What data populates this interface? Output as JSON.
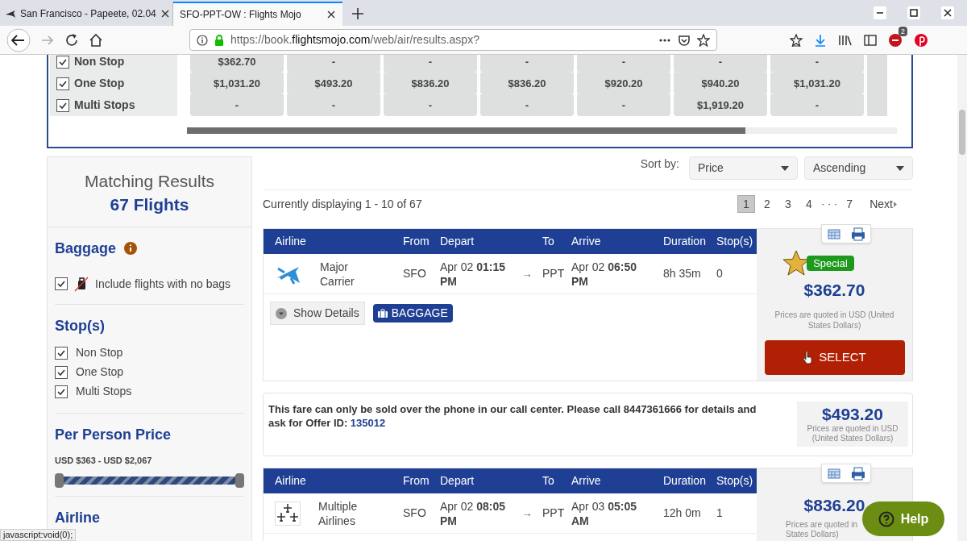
{
  "browser": {
    "tabs": [
      {
        "title": "San Francisco - Papeete, 02.04",
        "selected": false,
        "favicon": {
          "kind": "plane"
        }
      },
      {
        "title": "SFO-PPT-OW : Flights Mojo",
        "selected": true
      }
    ],
    "url": {
      "scheme": "https://book.",
      "domain": "flightsmojo.com",
      "path": "/web/air/results.aspx?"
    },
    "extension_badge": "2"
  },
  "stop_matrix": {
    "rows": [
      {
        "label": "Non Stop",
        "checked": true,
        "cells": [
          "$362.70",
          "-",
          "-",
          "-",
          "-",
          "-",
          "-"
        ]
      },
      {
        "label": "One Stop",
        "checked": true,
        "cells": [
          "$1,031.20",
          "$493.20",
          "$836.20",
          "$836.20",
          "$920.20",
          "$940.20",
          "$1,031.20"
        ]
      },
      {
        "label": "Multi Stops",
        "checked": true,
        "cells": [
          "-",
          "-",
          "-",
          "-",
          "-",
          "$1,919.20",
          "-"
        ]
      }
    ]
  },
  "sidebar": {
    "title": "Matching Results",
    "count": "67 Flights",
    "baggage": {
      "title": "Baggage",
      "option": {
        "label": "Include flights with no bags",
        "checked": true
      }
    },
    "stops": {
      "title": "Stop(s)",
      "options": [
        {
          "label": "Non Stop",
          "checked": true
        },
        {
          "label": "One Stop",
          "checked": true
        },
        {
          "label": "Multi Stops",
          "checked": true
        }
      ]
    },
    "price": {
      "title": "Per Person Price",
      "range": "USD $363 - USD $2,067"
    },
    "airline": {
      "title": "Airline"
    }
  },
  "results": {
    "sort_label": "Sort by:",
    "sort_fields": [
      "Price",
      "Ascending"
    ],
    "summary": "Currently displaying 1 - 10 of 67",
    "pages": [
      {
        "kind": "page",
        "label": "1",
        "selected": true
      },
      {
        "kind": "page",
        "label": "2",
        "selected": false
      },
      {
        "kind": "page",
        "label": "3",
        "selected": false
      },
      {
        "kind": "page",
        "label": "4",
        "selected": false
      },
      {
        "kind": "gap",
        "label": "· · ·"
      },
      {
        "kind": "page",
        "label": "7",
        "selected": false
      }
    ],
    "next": "Next",
    "cards": [
      {
        "kind": "flight",
        "columns": [
          "Airline",
          "From",
          "Depart",
          "To",
          "Arrive",
          "Duration",
          "Stop(s)"
        ],
        "logo": {
          "kind": "single"
        },
        "airline": "Major Carrier",
        "from": "SFO",
        "depart_date": "Apr 02",
        "depart_time": "01:15 PM",
        "arrow": "→",
        "to": "PPT",
        "arrive_date": "Apr 02",
        "arrive_time": "06:50 PM",
        "duration": "8h 35m",
        "stops": "0",
        "special": "Special",
        "price": "$362.70",
        "note": "Prices are quoted in USD (United States Dollars)",
        "details": "Show Details",
        "baggage": "BAGGAGE",
        "select": "SELECT"
      },
      {
        "kind": "phone",
        "text": "This fare can only be sold over the phone in our call center. Please call 8447361666 for details and ask for Offer ID:",
        "offer_id": "135012",
        "price": "$493.20",
        "note": "Prices are quoted in USD (United States Dollars)"
      },
      {
        "kind": "flight",
        "columns": [
          "Airline",
          "From",
          "Depart",
          "To",
          "Arrive",
          "Duration",
          "Stop(s)"
        ],
        "logo": {
          "kind": "multiple"
        },
        "airline": "Multiple Airlines",
        "from": "SFO",
        "depart_date": "Apr 02",
        "depart_time": "08:05 PM",
        "arrow": "→",
        "to": "PPT",
        "arrive_date": "Apr 03",
        "arrive_time": "05:05 AM",
        "duration": "12h 0m",
        "stops": "1",
        "price": "$836.20",
        "note_lines": [
          "Prices are quoted in",
          "States Dollars)"
        ]
      }
    ]
  },
  "help": "Help",
  "status": "javascript:void(0);"
}
